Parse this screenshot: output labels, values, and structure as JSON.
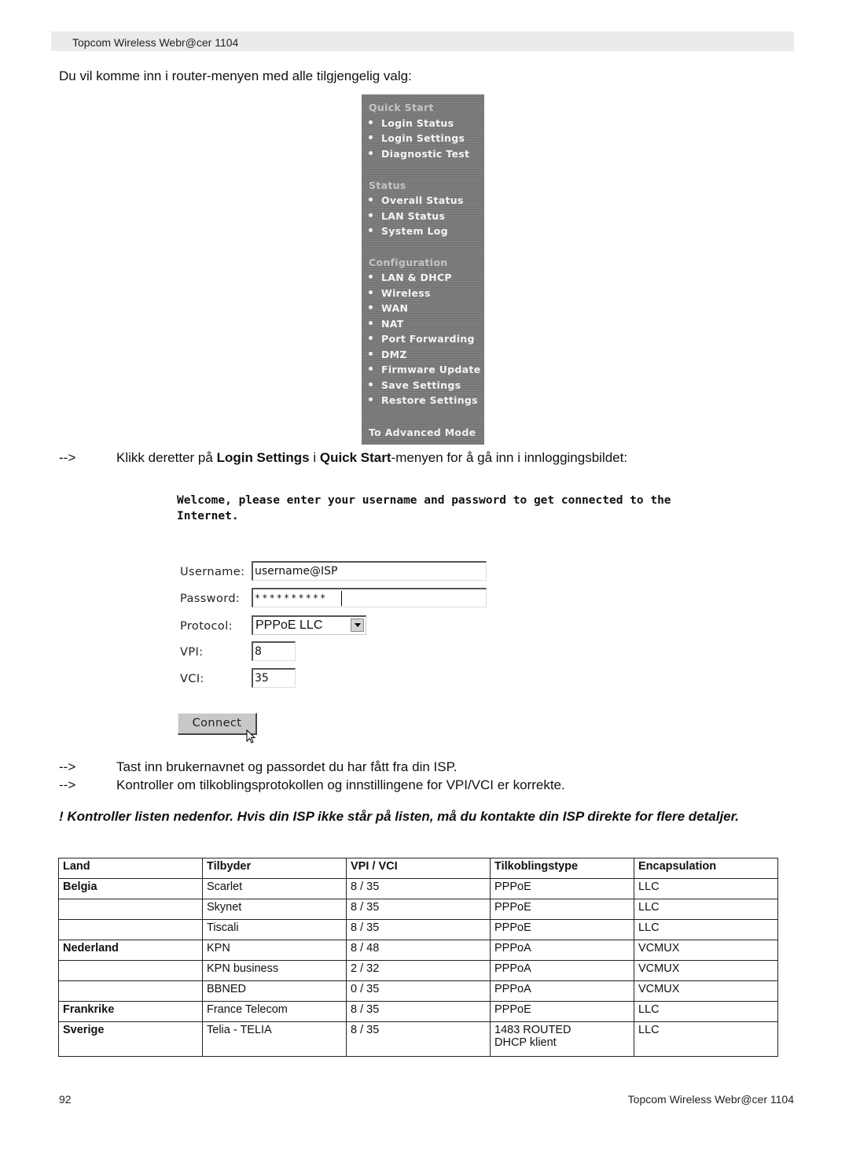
{
  "header": {
    "title": "Topcom Wireless Webr@cer 1104"
  },
  "intro_text": "Du vil komme inn i router-menyen med alle tilgjengelig valg:",
  "router_menu": {
    "sections": [
      {
        "title": "Quick Start",
        "items": [
          "Login Status",
          "Login Settings",
          "Diagnostic Test"
        ]
      },
      {
        "title": "Status",
        "items": [
          "Overall Status",
          "LAN Status",
          "System Log"
        ]
      },
      {
        "title": "Configuration",
        "items": [
          "LAN & DHCP",
          "Wireless",
          "WAN",
          "NAT",
          "Port Forwarding",
          "DMZ",
          "Firmware Update",
          "Save Settings",
          "Restore Settings"
        ]
      }
    ],
    "advanced_link": "To Advanced Mode"
  },
  "instruction1": {
    "arrow": "-->",
    "before": "Klikk deretter på ",
    "bold1": "Login Settings",
    "middle": " i ",
    "bold2": "Quick Start",
    "after": "-menyen for å gå inn i innloggingsbildet:"
  },
  "login_form": {
    "welcome": "Welcome, please enter your username and password to get connected to the Internet.",
    "username_label": "Username:",
    "username_value": "username@ISP",
    "password_label": "Password:",
    "password_value": "**********",
    "protocol_label": "Protocol:",
    "protocol_value": "PPPoE LLC",
    "vpi_label": "VPI:",
    "vpi_value": "8",
    "vci_label": "VCI:",
    "vci_value": "35",
    "connect_label": "Connect"
  },
  "instructions": [
    {
      "arrow": "-->",
      "text": "Tast inn brukernavnet og passordet du har fått fra din ISP."
    },
    {
      "arrow": "-->",
      "text": "Kontroller om tilkoblingsprotokollen og innstillingene for VPI/VCI er korrekte."
    }
  ],
  "warning": "! Kontroller listen nedenfor. Hvis din ISP ikke står på listen, må du kontakte din ISP direkte for flere detaljer.",
  "isp_table": {
    "headers": [
      "Land",
      "Tilbyder",
      "VPI / VCI",
      "Tilkoblingstype",
      "Encapsulation"
    ],
    "rows": [
      [
        "Belgia",
        "Scarlet",
        "8 / 35",
        "PPPoE",
        "LLC"
      ],
      [
        "",
        "Skynet",
        "8 / 35",
        "PPPoE",
        "LLC"
      ],
      [
        "",
        "Tiscali",
        "8 / 35",
        "PPPoE",
        "LLC"
      ],
      [
        "Nederland",
        "KPN",
        "8 / 48",
        "PPPoA",
        "VCMUX"
      ],
      [
        "",
        "KPN business",
        "2 / 32",
        "PPPoA",
        "VCMUX"
      ],
      [
        "",
        "BBNED",
        "0 / 35",
        "PPPoA",
        "VCMUX"
      ],
      [
        "Frankrike",
        "France Telecom",
        "8 / 35",
        "PPPoE",
        "LLC"
      ],
      [
        "Sverige",
        "Telia - TELIA",
        "8 / 35",
        "1483 ROUTED\nDHCP klient",
        "LLC"
      ]
    ]
  },
  "footer": {
    "page_number": "92",
    "title": "Topcom Wireless Webr@cer 1104"
  }
}
